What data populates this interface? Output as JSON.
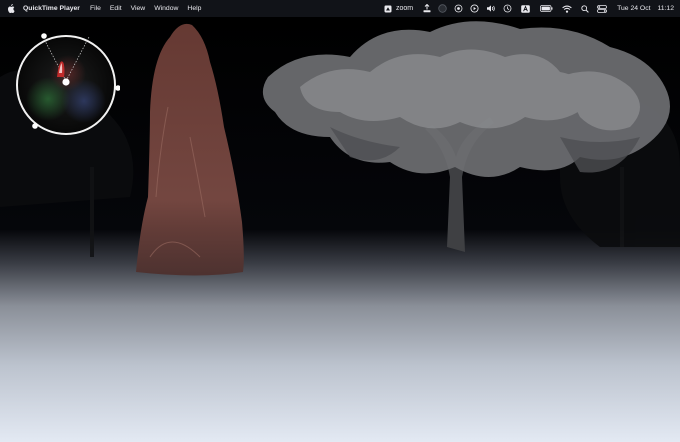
{
  "menubar": {
    "app_name": "QuickTime Player",
    "menus": [
      "File",
      "Edit",
      "View",
      "Window",
      "Help"
    ],
    "zoom_label": "zoom",
    "date": "Tue 24 Oct",
    "time": "11:12",
    "status_icons": [
      "zoom-app-icon",
      "upload-icon",
      "circle-icon",
      "play-circle-icon",
      "volume-icon",
      "history-icon",
      "input-source-icon",
      "battery-icon",
      "wifi-icon",
      "search-icon",
      "control-center-icon"
    ]
  },
  "colors": {
    "menubar_bg": "#111318",
    "figure": "#7a4a44",
    "fog": "#dfe6f2"
  }
}
